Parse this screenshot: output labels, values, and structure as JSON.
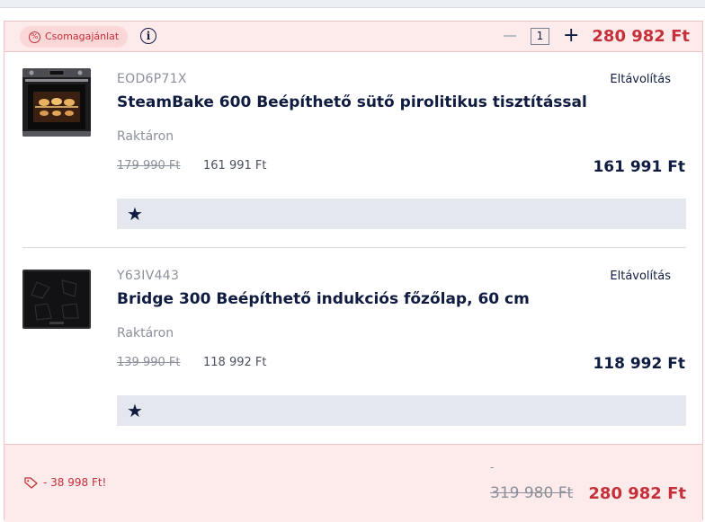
{
  "bundle": {
    "badge_label": "Csomagajánlat",
    "badge_icon": "percent-icon",
    "info_icon": "info-icon",
    "quantity": "1",
    "total": "280 982 Ft"
  },
  "items": [
    {
      "sku": "EOD6P71X",
      "title": "SteamBake 600 Beépíthető sütő pirolitikus tisztítással",
      "stock": "Raktáron",
      "old_price": "179 990 Ft",
      "new_price": "161 991 Ft",
      "line_price": "161 991 Ft",
      "remove_label": "Eltávolítás",
      "image": "oven-thumbnail"
    },
    {
      "sku": "Y63IV443",
      "title": "Bridge 300 Beépíthető indukciós főzőlap, 60 cm",
      "stock": "Raktáron",
      "old_price": "139 990 Ft",
      "new_price": "118 992 Ft",
      "line_price": "118 992 Ft",
      "remove_label": "Eltávolítás",
      "image": "hob-thumbnail"
    }
  ],
  "footer": {
    "savings": "- 38 998 Ft!",
    "dash": "-",
    "old_total": "319 980 Ft",
    "total": "280 982 Ft"
  },
  "colors": {
    "accent": "#c4313a",
    "navy": "#0f1c40",
    "pink_bg": "#fdeaea"
  }
}
